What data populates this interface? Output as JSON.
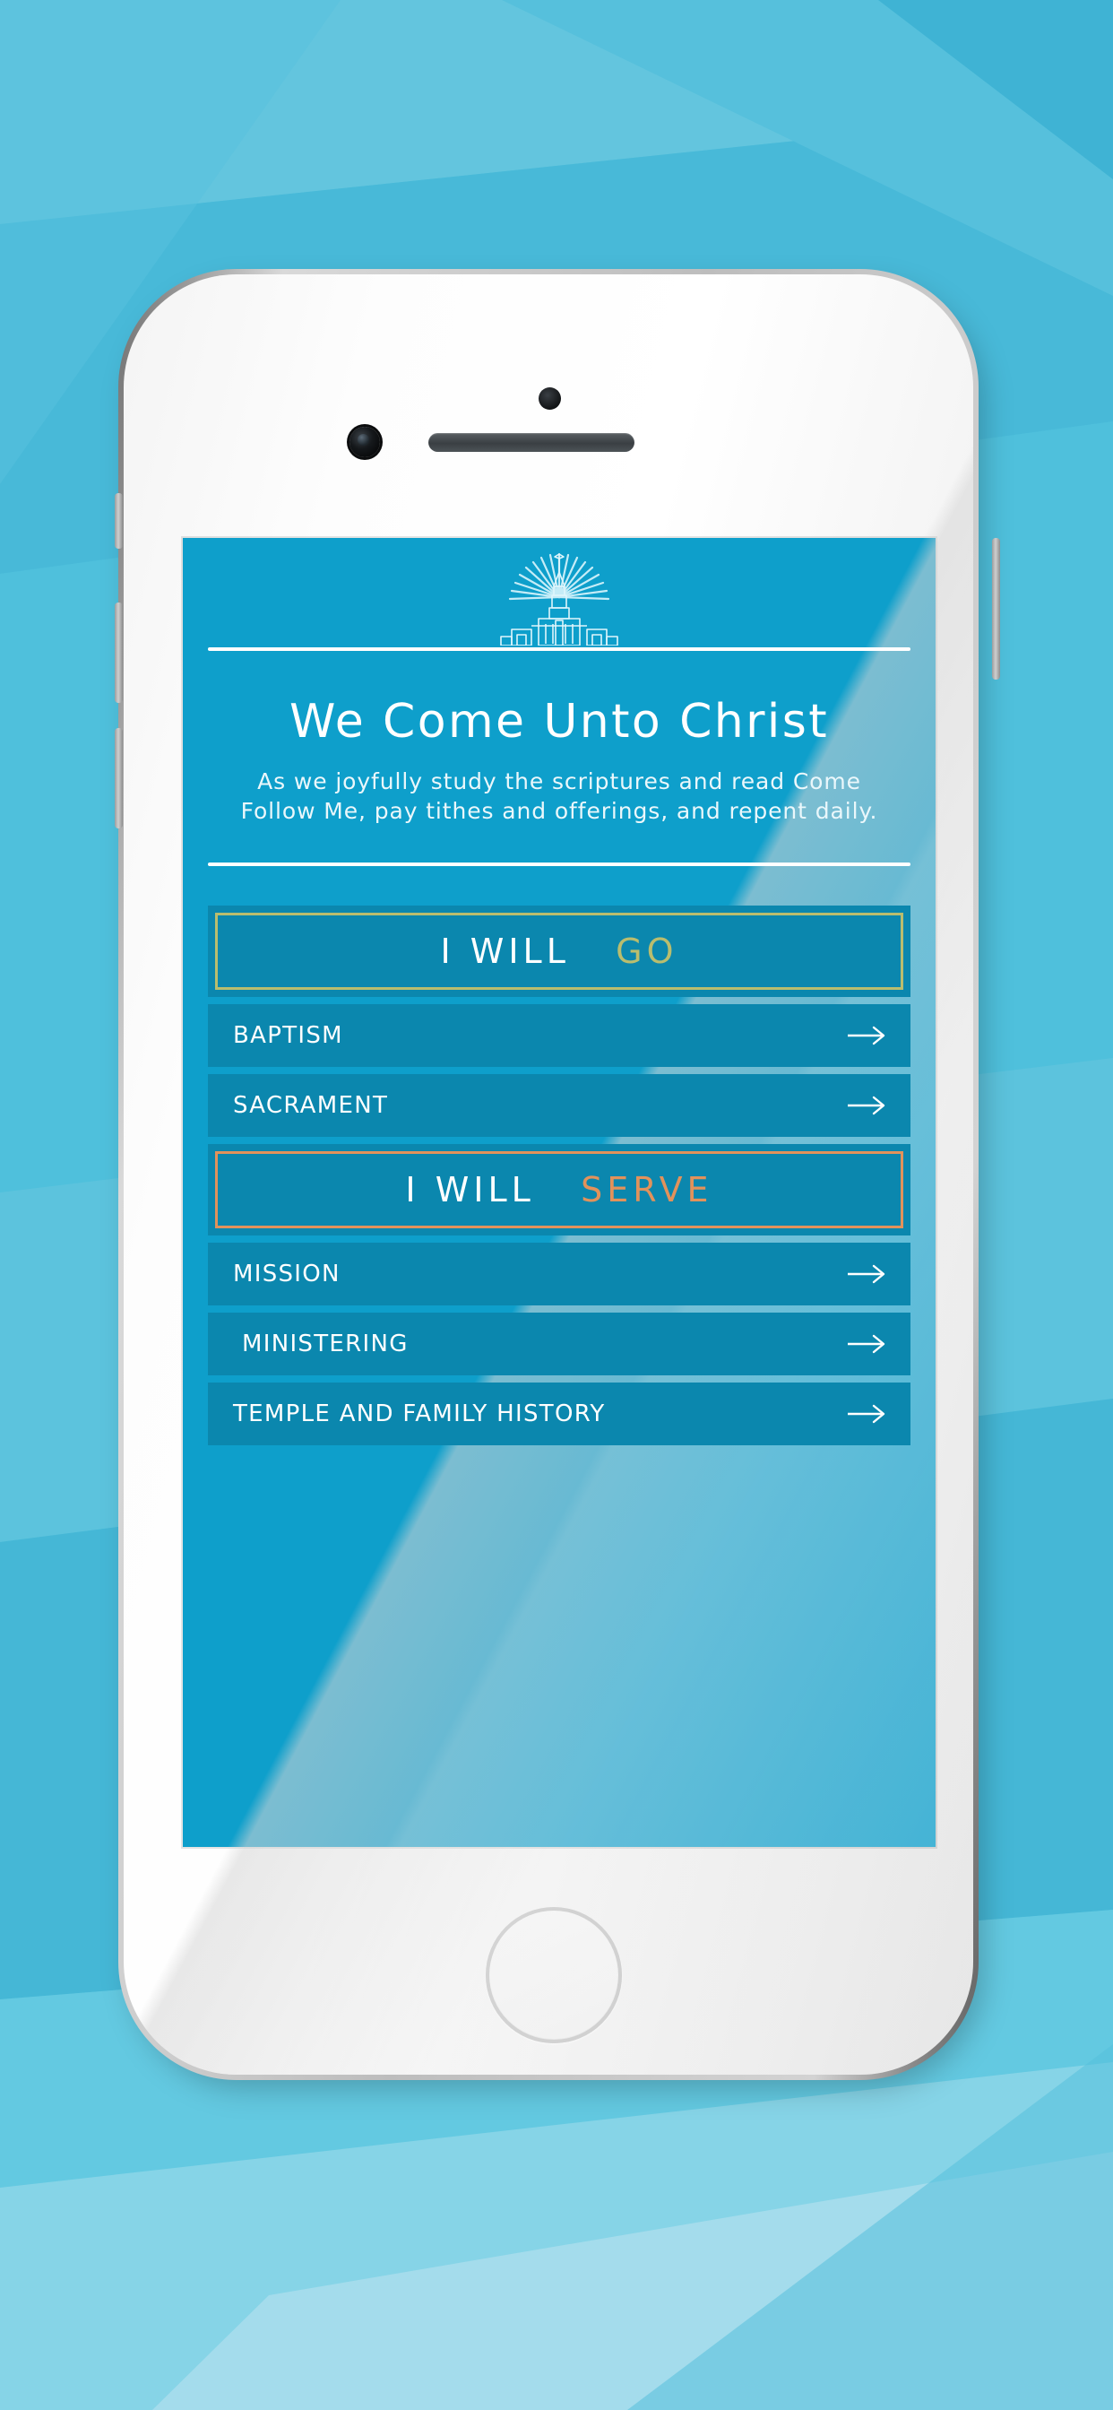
{
  "device": {
    "type": "smartphone-mockup",
    "hardware": {
      "camera": "front-camera-icon",
      "sensor": "proximity-sensor-icon",
      "speaker": "earpiece-speaker-icon",
      "home_button": "home-button",
      "mute_switch": "mute-switch-button",
      "volume_up": "volume-up-button",
      "volume_down": "volume-down-button",
      "power": "power-button"
    }
  },
  "colors": {
    "page_background": "#4FC0DC",
    "page_background_light": "#63C5DE",
    "page_background_lighter": "#A4DCEC",
    "page_background_dark": "#2FA8C8",
    "screen_background": "#0E9FCB",
    "tile_background": "#0B87AE",
    "accent_go": "#B9BD6E",
    "accent_serve": "#E2925B",
    "text_white": "#FFFFFF",
    "text_subtle": "#EAF7FB"
  },
  "app": {
    "logo": {
      "icon": "temple-icon",
      "description": "temple-with-spire-and-sun-rays"
    },
    "header": {
      "title": "We Come Unto Christ",
      "subtitle": "As we joyfully study the scriptures and read Come Follow Me, pay tithes and offerings, and repent daily."
    },
    "sections": [
      {
        "id": "go",
        "prefix": "I WILL",
        "accent_word": "GO",
        "accent_color": "#B9BD6E",
        "items": [
          {
            "label": "BAPTISM",
            "arrow": "arrow-right-icon",
            "indent": false
          },
          {
            "label": "SACRAMENT",
            "arrow": "arrow-right-icon",
            "indent": false
          }
        ]
      },
      {
        "id": "serve",
        "prefix": "I WILL",
        "accent_word": "SERVE",
        "accent_color": "#E2925B",
        "items": [
          {
            "label": "MISSION",
            "arrow": "arrow-right-icon",
            "indent": false
          },
          {
            "label": "MINISTERING",
            "arrow": "arrow-right-icon",
            "indent": true
          },
          {
            "label": "TEMPLE AND FAMILY HISTORY",
            "arrow": "arrow-right-icon",
            "indent": false
          }
        ]
      }
    ]
  }
}
